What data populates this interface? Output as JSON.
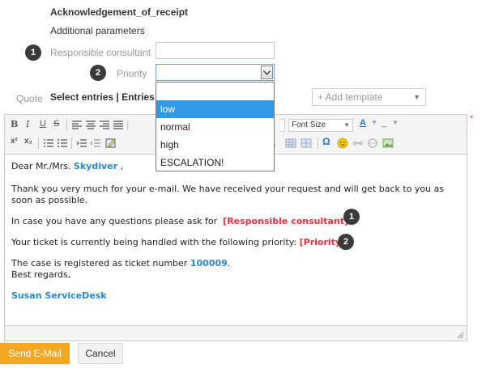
{
  "header": {
    "title": "Acknowledgement_of_receipt",
    "section": "Additional parameters"
  },
  "params": {
    "responsible_label": "Responsible consultant",
    "responsible_value": "",
    "priority_label": "Priority",
    "priority_value": "",
    "badge1": "1",
    "badge2": "2"
  },
  "priority_dropdown": {
    "options": [
      "",
      "low",
      "normal",
      "high",
      "ESCALATION!"
    ],
    "highlighted": "low"
  },
  "quote": {
    "label": "Quote",
    "select_entries": "Select entries",
    "divider": "|",
    "entries_v": "Entries v",
    "add_template": "+ Add template"
  },
  "toolbar": {
    "font_size": "Font Size"
  },
  "email": {
    "greeting_prefix": "Dear Mr./Mrs.",
    "customer_name": "Skydiver",
    "greeting_suffix": ",",
    "line1": "Thank you very much for your e-mail. We have received your request and will get back to you as soon as possible.",
    "line2_prefix": "In case you have any questions please ask for",
    "line2_placeholder": "[Responsible consultant]",
    "line3_prefix": "Your ticket is currently being handled with the following priority:",
    "line3_placeholder": "[Priority]",
    "line4_prefix": "The case is registered as ticket number",
    "ticket_number": "100009",
    "line4_suffix": ".",
    "closing": "Best regards,",
    "signature": "Susan ServiceDesk"
  },
  "required_marker": "*",
  "actions": {
    "send": "Send E-Mail",
    "cancel": "Cancel"
  }
}
